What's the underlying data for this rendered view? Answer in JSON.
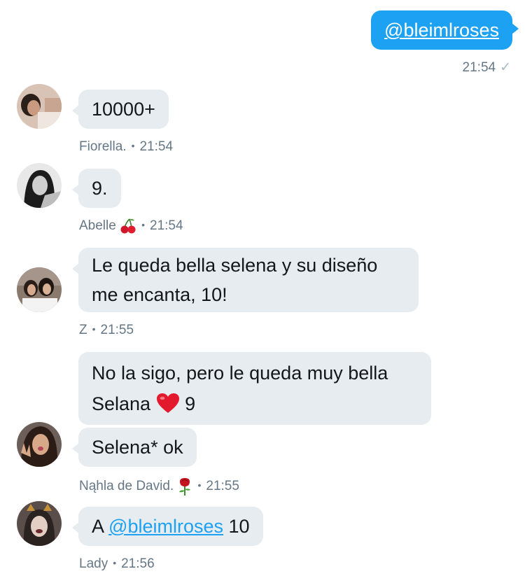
{
  "outgoing": {
    "text": "@bleimlroses",
    "time": "21:54",
    "status": "✓"
  },
  "messages": [
    {
      "text": "10000+",
      "author": "Fiorella.",
      "time": "21:54"
    },
    {
      "text": "9.",
      "author": "Abelle",
      "time": "21:54",
      "author_emoji": "cherries"
    },
    {
      "line1": "Le queda bella selena y su diseño",
      "line2": "me encanta, 10!",
      "author": "Z",
      "time": "21:55"
    },
    {
      "line1": "No la sigo, pero le queda muy bella",
      "line2_text": "Selana",
      "line2_after": "9",
      "emoji": "red-heart"
    },
    {
      "text": "Selena* ok",
      "author": "Nąhla de David.",
      "time": "21:55",
      "author_emoji": "rose"
    },
    {
      "prefix": "A",
      "mention": "@bleimlroses",
      "suffix": "10",
      "author": "Lady",
      "time": "21:56"
    }
  ],
  "colors": {
    "accent": "#1da1f2",
    "bubble": "#e6ecf0",
    "meta": "#657786"
  }
}
